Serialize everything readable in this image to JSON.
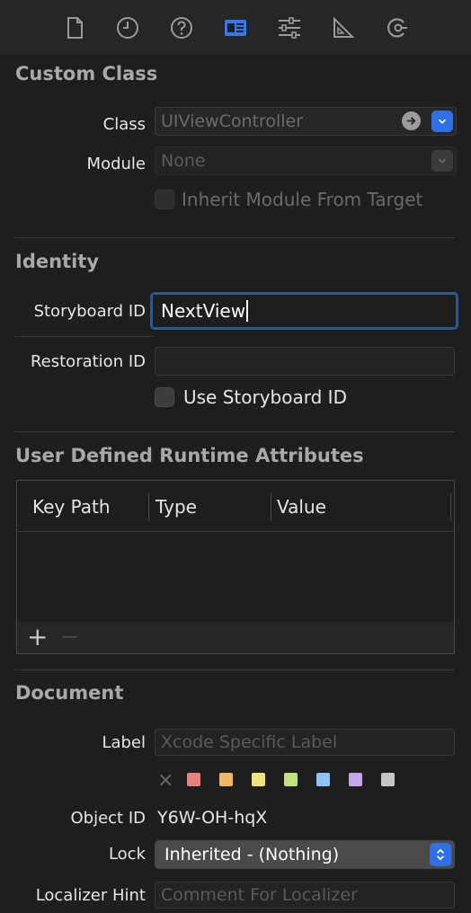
{
  "toolbar": {
    "icons": [
      "file-inspector-icon",
      "history-inspector-icon",
      "quick-help-icon",
      "identity-inspector-icon",
      "attributes-inspector-icon",
      "size-inspector-icon",
      "connections-inspector-icon"
    ],
    "active_color": "#2f7bf5"
  },
  "custom_class": {
    "title": "Custom Class",
    "class_label": "Class",
    "class_placeholder": "UIViewController",
    "module_label": "Module",
    "module_value": "None",
    "inherit_label": "Inherit Module From Target"
  },
  "identity": {
    "title": "Identity",
    "storyboard_label": "Storyboard ID",
    "storyboard_value": "NextView",
    "restoration_label": "Restoration ID",
    "restoration_value": "",
    "use_storyboard_label": "Use Storyboard ID"
  },
  "runtime": {
    "title": "User Defined Runtime Attributes",
    "columns": [
      "Key Path",
      "Type",
      "Value"
    ],
    "add_symbol": "+",
    "remove_symbol": "—"
  },
  "document": {
    "title": "Document",
    "label_label": "Label",
    "label_placeholder": "Xcode Specific Label",
    "clear_symbol": "×",
    "colors": [
      "#e8827d",
      "#f2b568",
      "#f1e27a",
      "#bfe27f",
      "#8fc3f5",
      "#c5a6e6",
      "#c6c6c6"
    ],
    "object_id_label": "Object ID",
    "object_id_value": "Y6W-OH-hqX",
    "lock_label": "Lock",
    "lock_value": "Inherited - (Nothing)",
    "localizer_label": "Localizer Hint",
    "localizer_placeholder": "Comment For Localizer"
  }
}
